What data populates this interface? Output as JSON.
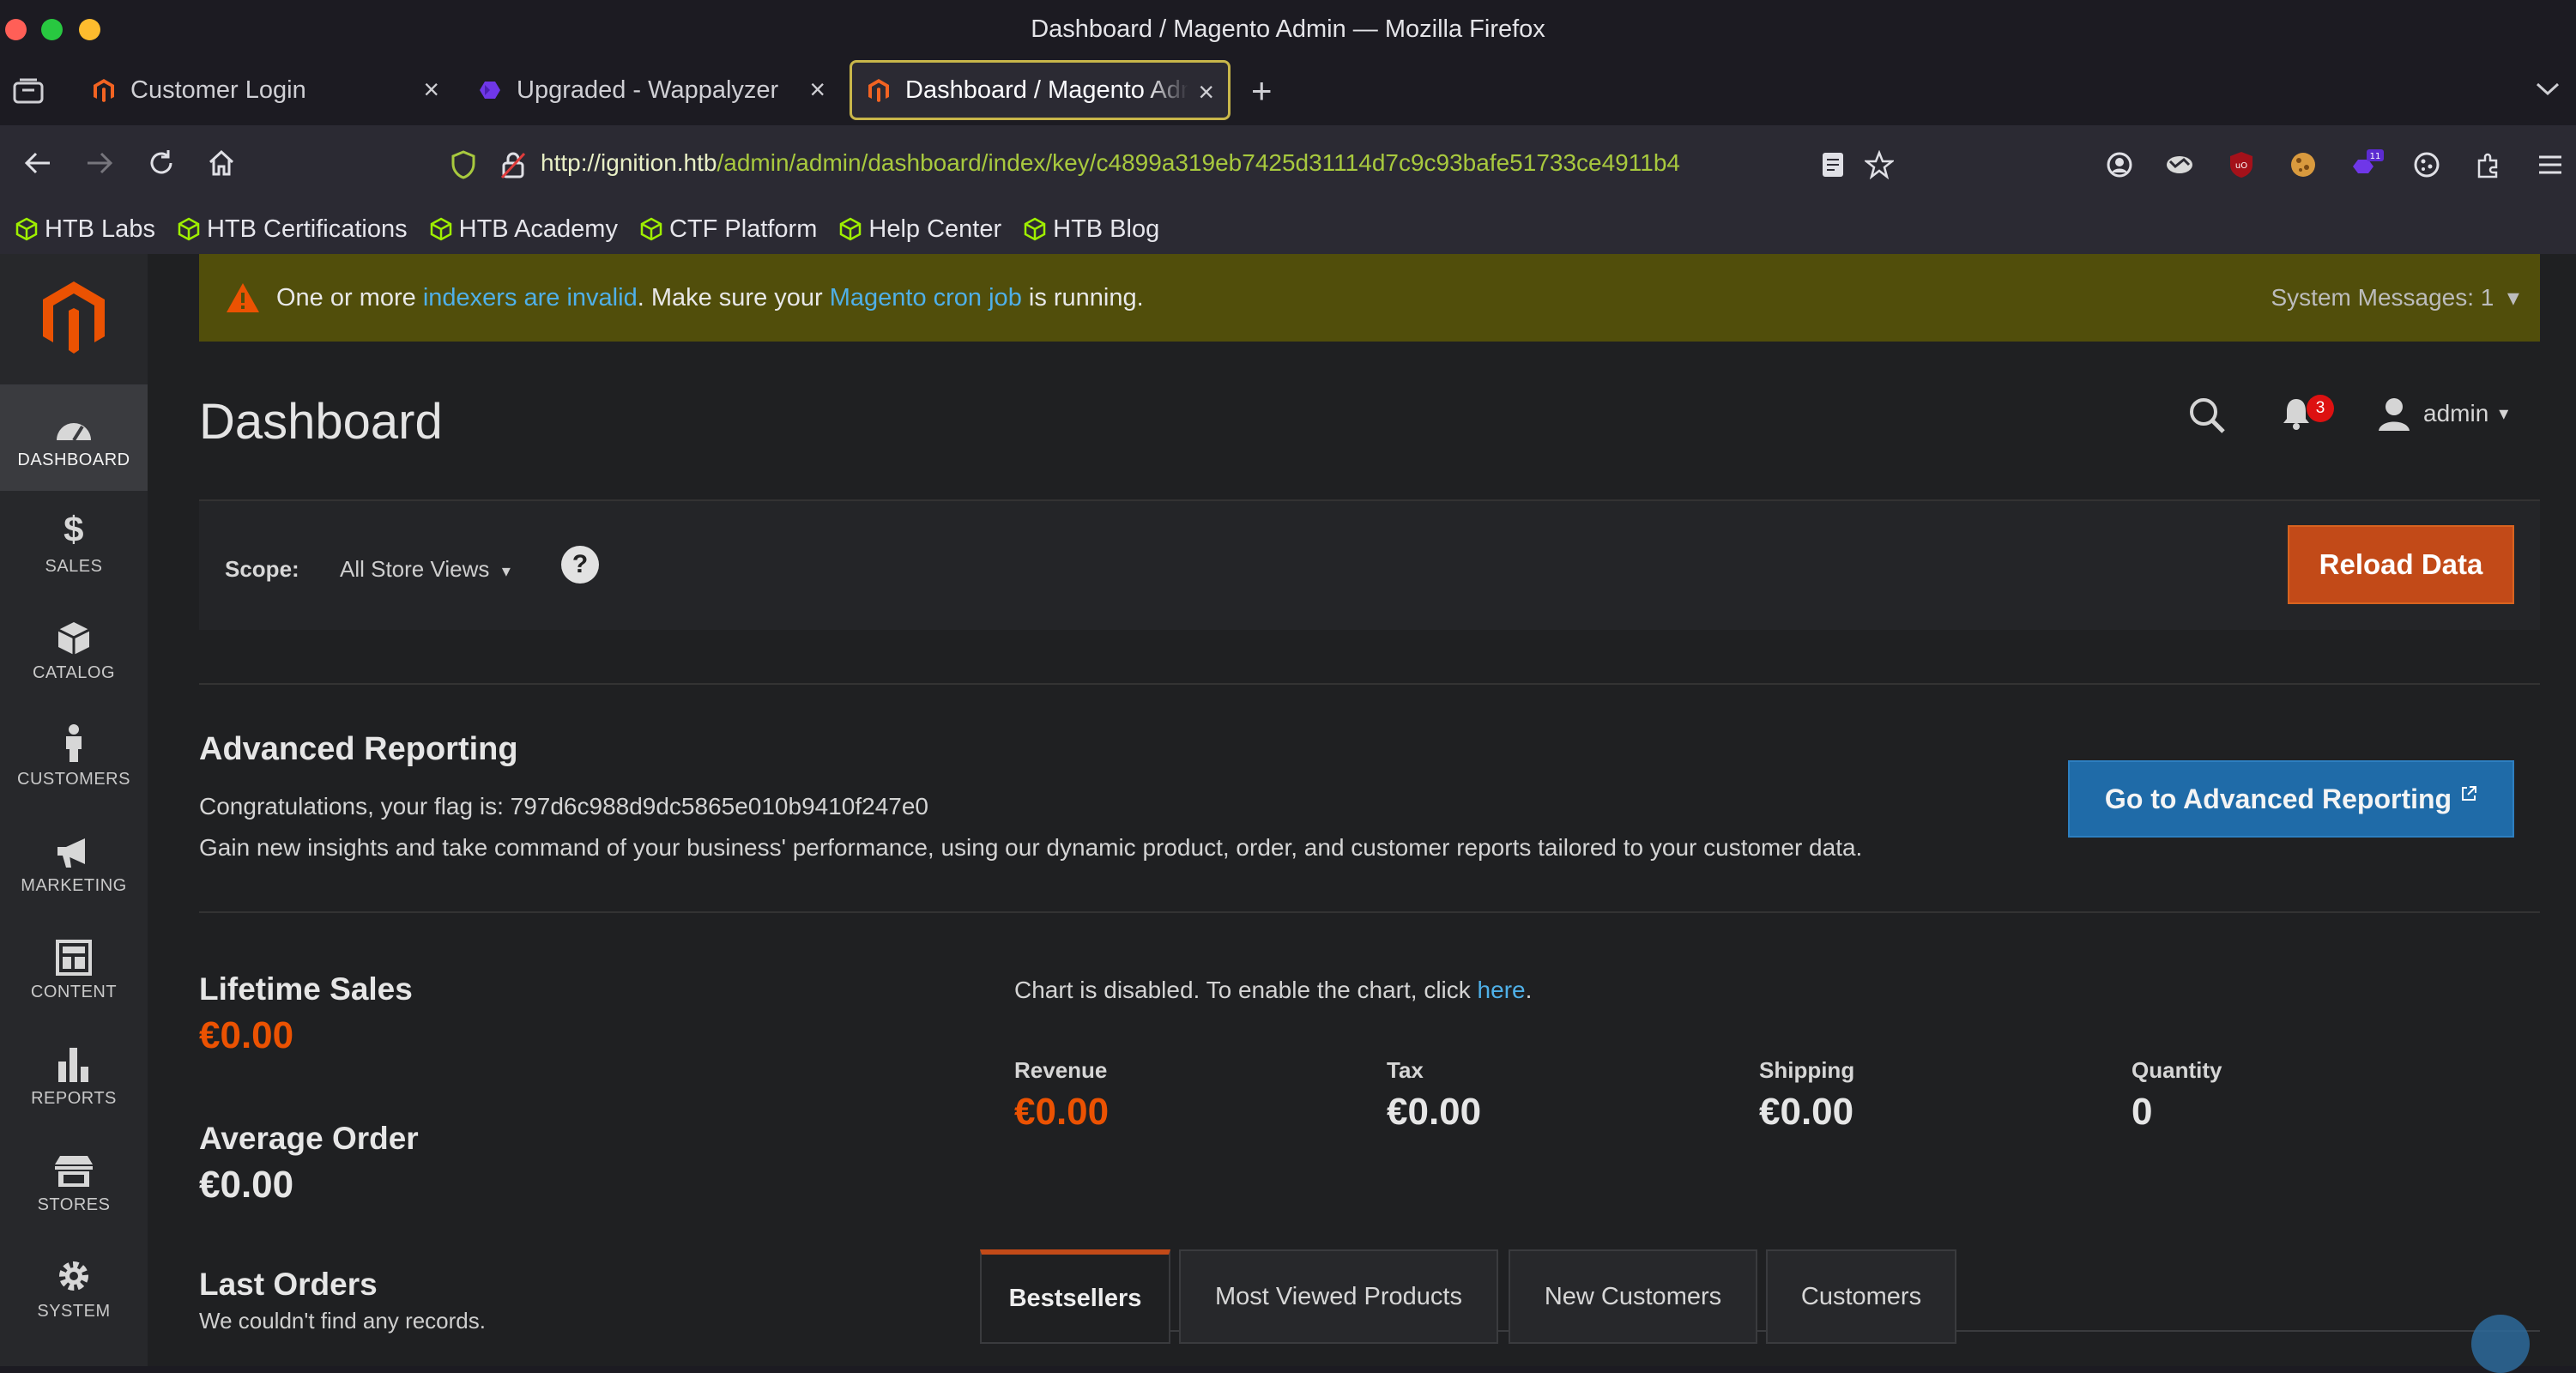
{
  "window": {
    "title": "Dashboard / Magento Admin — Mozilla Firefox"
  },
  "tabs": [
    {
      "label": "Customer Login",
      "active": false
    },
    {
      "label": "Upgraded - Wappalyzer",
      "active": false
    },
    {
      "label": "Dashboard / Magento Admin",
      "active": true
    }
  ],
  "url": {
    "host": "http://ignition.htb",
    "path": "/admin/admin/dashboard/index/key/c4899a319eb7425d31114d7c9c93bafe51733ce4911b4"
  },
  "extensions": {
    "badge_count": "11"
  },
  "bookmarks": [
    "HTB Labs",
    "HTB Certifications",
    "HTB Academy",
    "CTF Platform",
    "Help Center",
    "HTB Blog"
  ],
  "sidebar": [
    {
      "label": "DASHBOARD",
      "icon": "dashboard-icon",
      "active": true
    },
    {
      "label": "SALES",
      "icon": "dollar-icon"
    },
    {
      "label": "CATALOG",
      "icon": "box-icon"
    },
    {
      "label": "CUSTOMERS",
      "icon": "person-icon"
    },
    {
      "label": "MARKETING",
      "icon": "megaphone-icon"
    },
    {
      "label": "CONTENT",
      "icon": "layout-icon"
    },
    {
      "label": "REPORTS",
      "icon": "bar-chart-icon"
    },
    {
      "label": "STORES",
      "icon": "storefront-icon"
    },
    {
      "label": "SYSTEM",
      "icon": "gear-icon"
    }
  ],
  "system_message": {
    "prefix": "One or more ",
    "link1": "indexers are invalid",
    "middle": ". Make sure your ",
    "link2": "Magento cron job",
    "suffix": " is running.",
    "count_label": "System Messages: 1"
  },
  "header": {
    "title": "Dashboard",
    "notifications": "3",
    "user": "admin"
  },
  "scope": {
    "label": "Scope:",
    "value": "All Store Views",
    "reload": "Reload Data"
  },
  "advanced_reporting": {
    "title": "Advanced Reporting",
    "flag_text": "Congratulations, your flag is: 797d6c988d9dc5865e010b9410f247e0",
    "description": "Gain new insights and take command of your business' performance, using our dynamic product, order, and customer reports tailored to your customer data.",
    "button": "Go to Advanced Reporting"
  },
  "stats": {
    "lifetime_sales": {
      "label": "Lifetime Sales",
      "value": "€0.00"
    },
    "average_order": {
      "label": "Average Order",
      "value": "€0.00"
    },
    "last_orders": {
      "label": "Last Orders",
      "empty": "We couldn't find any records."
    }
  },
  "chart_notice": {
    "text": "Chart is disabled. To enable the chart, click ",
    "link": "here",
    "end": "."
  },
  "totals": [
    {
      "label": "Revenue",
      "value": "€0.00"
    },
    {
      "label": "Tax",
      "value": "€0.00"
    },
    {
      "label": "Shipping",
      "value": "€0.00"
    },
    {
      "label": "Quantity",
      "value": "0"
    }
  ],
  "dashboard_tabs": [
    "Bestsellers",
    "Most Viewed Products",
    "New Customers",
    "Customers"
  ],
  "colors": {
    "accent": "#eb5202",
    "link": "#4fb0e8",
    "warning_bg": "#514e0b",
    "primary_btn": "#1f6ba8"
  }
}
